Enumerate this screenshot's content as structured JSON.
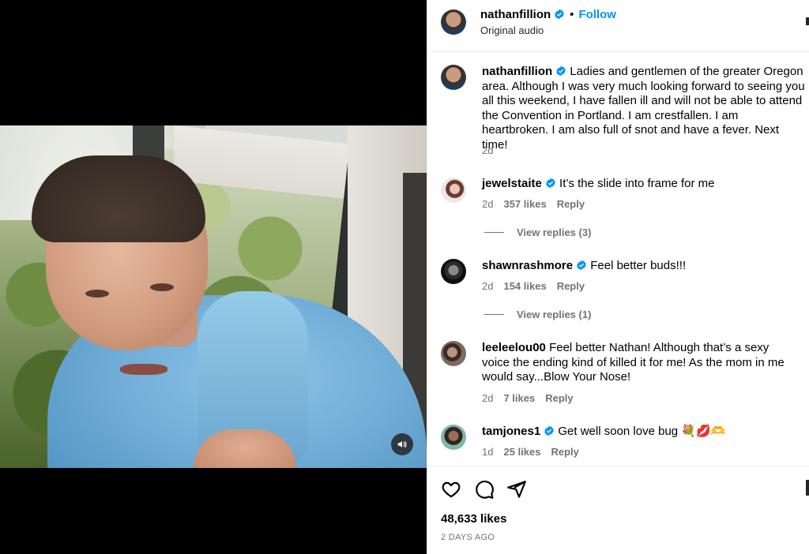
{
  "post": {
    "username": "nathanfillion",
    "follow_label": "Follow",
    "dot": "•",
    "audio_label": "Original audio",
    "caption": "Ladies and gentlemen of the greater Oregon area. Although I was very much looking forward to seeing you all this weekend, I have fallen ill and will not be able to attend the Convention in Portland. I am crestfallen. I am heartbroken. I am also full of snot and have a fever. Next time!",
    "caption_age": "2d",
    "likes": "48,633 likes",
    "posted": "2 DAYS AGO"
  },
  "comments": [
    {
      "username": "jewelstaite",
      "verified": true,
      "text": "It’s the slide into frame for me",
      "age": "2d",
      "likes": "357 likes",
      "reply": "Reply",
      "view_replies": "View replies (3)"
    },
    {
      "username": "shawnrashmore",
      "verified": true,
      "text": "Feel better buds!!!",
      "age": "2d",
      "likes": "154 likes",
      "reply": "Reply",
      "view_replies": "View replies (1)"
    },
    {
      "username": "leeleelou00",
      "verified": false,
      "text": "Feel better Nathan! Although that’s a sexy voice the ending kind of killed it for me! As the mom in me would say...Blow Your Nose!",
      "age": "2d",
      "likes": "7 likes",
      "reply": "Reply"
    },
    {
      "username": "tamjones1",
      "verified": true,
      "text": "Get well soon love bug 💐💋🫶",
      "age": "1d",
      "likes": "25 likes",
      "reply": "Reply"
    }
  ],
  "colors": {
    "accent": "#0095f6",
    "verified": "#0095f6",
    "muted": "#737373"
  },
  "icons": [
    "heart-icon",
    "comment-icon",
    "share-icon",
    "verified-icon",
    "volume-icon"
  ]
}
